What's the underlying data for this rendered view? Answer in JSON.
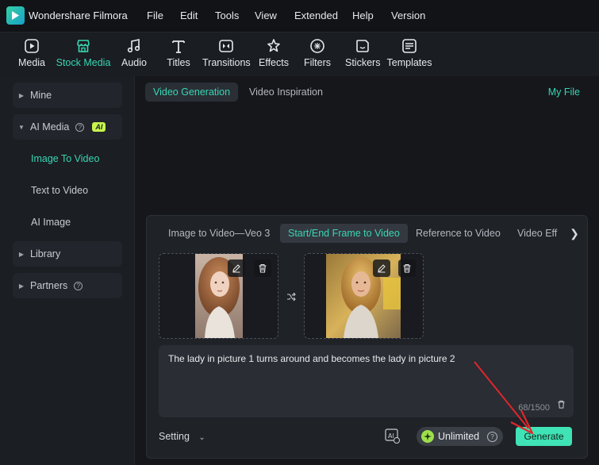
{
  "app": {
    "name": "Wondershare Filmora"
  },
  "menu": [
    "File",
    "Edit",
    "Tools",
    "View",
    "Extended",
    "Help",
    "Version"
  ],
  "toolbar": {
    "items": [
      {
        "label": "Media",
        "icon": "media-icon"
      },
      {
        "label": "Stock Media",
        "icon": "stock-media-icon",
        "active": true
      },
      {
        "label": "Audio",
        "icon": "audio-icon"
      },
      {
        "label": "Titles",
        "icon": "titles-icon"
      },
      {
        "label": "Transitions",
        "icon": "transitions-icon"
      },
      {
        "label": "Effects",
        "icon": "effects-icon"
      },
      {
        "label": "Filters",
        "icon": "filters-icon"
      },
      {
        "label": "Stickers",
        "icon": "stickers-icon"
      },
      {
        "label": "Templates",
        "icon": "templates-icon"
      }
    ]
  },
  "sidebar": {
    "mine": "Mine",
    "ai_media": "AI Media",
    "ai_badge": "AI",
    "sub_items": [
      "Image To Video",
      "Text to Video",
      "AI Image"
    ],
    "library": "Library",
    "partners": "Partners"
  },
  "main": {
    "tabs": [
      "Video Generation",
      "Video Inspiration"
    ],
    "my_file": "My File",
    "gen_tabs": [
      "Image to Video—Veo 3",
      "Start/End Frame to Video",
      "Reference to Video",
      "Video Eff"
    ],
    "prompt": "The lady in picture 1 turns around and becomes the lady in picture 2",
    "counter": "68/1500",
    "setting": "Setting",
    "unlimited": "Unlimited",
    "generate": "Generate"
  },
  "colors": {
    "accent": "#38d6b2",
    "generate_bg": "#3fe3b5",
    "ai_badge": "#c7f54e",
    "annotation_arrow": "#e0262b"
  }
}
